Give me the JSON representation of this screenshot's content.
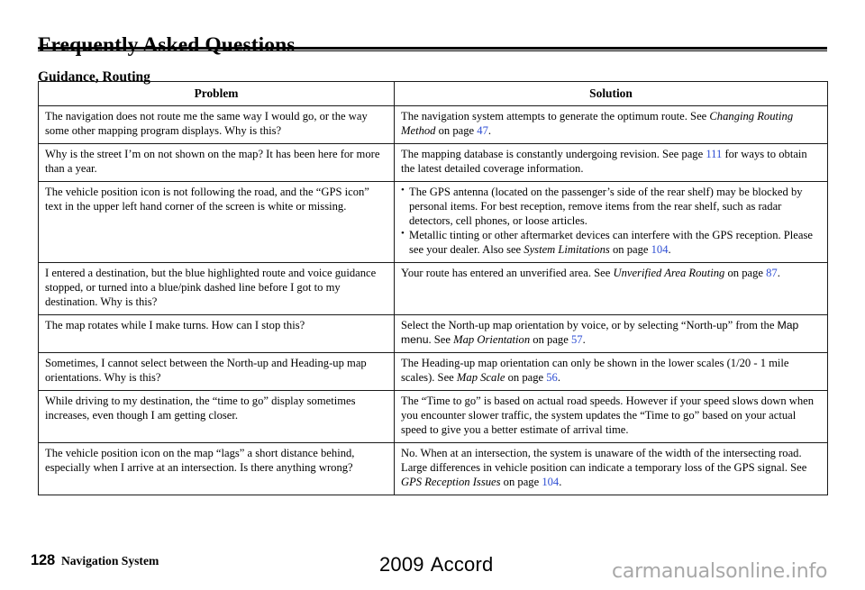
{
  "header": {
    "title": "Frequently Asked Questions",
    "section": "Guidance, Routing"
  },
  "table": {
    "columns": [
      {
        "key": "problem",
        "label": "Problem"
      },
      {
        "key": "solution",
        "label": "Solution"
      }
    ],
    "rows": [
      {
        "problem": "The navigation does not route me the same way I would go, or the way some other mapping program displays. Why is this?",
        "solution_parts": [
          {
            "text": "The navigation system attempts to generate the optimum route. See ",
            "style": "normal"
          },
          {
            "text": "Changing Routing Method",
            "style": "italic"
          },
          {
            "text": " on page ",
            "style": "normal"
          },
          {
            "text": "47",
            "style": "page-ref"
          },
          {
            "text": ".",
            "style": "normal"
          }
        ]
      },
      {
        "problem": "Why is the street I’m on not shown on the map? It has been here for more than a year.",
        "solution_parts": [
          {
            "text": "The mapping database is constantly undergoing revision. See page ",
            "style": "normal"
          },
          {
            "text": "111",
            "style": "page-ref"
          },
          {
            "text": " for ways to obtain the latest detailed coverage information.",
            "style": "normal"
          }
        ]
      },
      {
        "problem": "The vehicle position icon is not following the road, and the “GPS icon” text in the upper left hand corner of the screen is white or missing.",
        "solution_bullets": [
          [
            {
              "text": "The GPS antenna (located on the passenger’s side of the rear shelf) may be blocked by personal items. For best reception, remove items from the rear shelf, such as radar detectors, cell phones, or loose articles.",
              "style": "normal"
            }
          ],
          [
            {
              "text": "Metallic tinting or other aftermarket devices can interfere with the GPS reception. Please see your dealer. Also see ",
              "style": "normal"
            },
            {
              "text": "System Limitations",
              "style": "italic"
            },
            {
              "text": " on page ",
              "style": "normal"
            },
            {
              "text": "104",
              "style": "page-ref"
            },
            {
              "text": ".",
              "style": "normal"
            }
          ]
        ]
      },
      {
        "problem": "I entered a destination, but the blue highlighted route and voice guidance stopped, or turned into a blue/pink dashed line before I got to my destination. Why is this?",
        "solution_parts": [
          {
            "text": "Your route has entered an unverified area. See ",
            "style": "normal"
          },
          {
            "text": "Unverified Area Routing",
            "style": "italic"
          },
          {
            "text": " on page ",
            "style": "normal"
          },
          {
            "text": "87",
            "style": "page-ref"
          },
          {
            "text": ".",
            "style": "normal"
          }
        ]
      },
      {
        "problem": "The map rotates while I make turns. How can I stop this?",
        "solution_parts": [
          {
            "text": "Select the North-up map orientation by voice, or by selecting “North-up” from the ",
            "style": "normal"
          },
          {
            "text": "Map menu",
            "style": "ui-label"
          },
          {
            "text": ". See ",
            "style": "normal"
          },
          {
            "text": "Map Orientation",
            "style": "italic"
          },
          {
            "text": " on page ",
            "style": "normal"
          },
          {
            "text": "57",
            "style": "page-ref"
          },
          {
            "text": ".",
            "style": "normal"
          }
        ]
      },
      {
        "problem": "Sometimes, I cannot select between the North-up and Heading-up map orientations. Why is this?",
        "solution_parts": [
          {
            "text": "The Heading-up map orientation can only be shown in the lower scales (1/20 - 1 mile scales). See ",
            "style": "normal"
          },
          {
            "text": "Map Scale",
            "style": "italic"
          },
          {
            "text": " on page ",
            "style": "normal"
          },
          {
            "text": "56",
            "style": "page-ref"
          },
          {
            "text": ".",
            "style": "normal"
          }
        ]
      },
      {
        "problem": "While driving to my destination, the “time to go” display sometimes increases, even though I am getting closer.",
        "solution_parts": [
          {
            "text": "The “Time to go” is based on actual road speeds. However if your speed slows down when you encounter slower traffic, the system updates the “Time to go” based on your actual speed to give you a better estimate of arrival time.",
            "style": "normal"
          }
        ]
      },
      {
        "problem": "The vehicle position icon on the map “lags” a short distance behind, especially when I arrive at an intersection. Is there anything wrong?",
        "solution_parts": [
          {
            "text": "No. When at an intersection, the system is unaware of the width of the intersecting road. Large differences in vehicle position can indicate a temporary loss of the GPS signal. See ",
            "style": "normal"
          },
          {
            "text": "GPS Reception Issues",
            "style": "italic"
          },
          {
            "text": " on page ",
            "style": "normal"
          },
          {
            "text": "104",
            "style": "page-ref"
          },
          {
            "text": ".",
            "style": "normal"
          }
        ]
      }
    ]
  },
  "footer": {
    "page_number": "128",
    "manual_name": "Navigation System",
    "model_year": "2009",
    "model_name": "Accord",
    "watermark": "carmanualsonline.info"
  },
  "colors": {
    "page_ref_link": "#2f4fd4",
    "text": "#000000",
    "rule": "#000000",
    "watermark": "#a8a8a8"
  }
}
